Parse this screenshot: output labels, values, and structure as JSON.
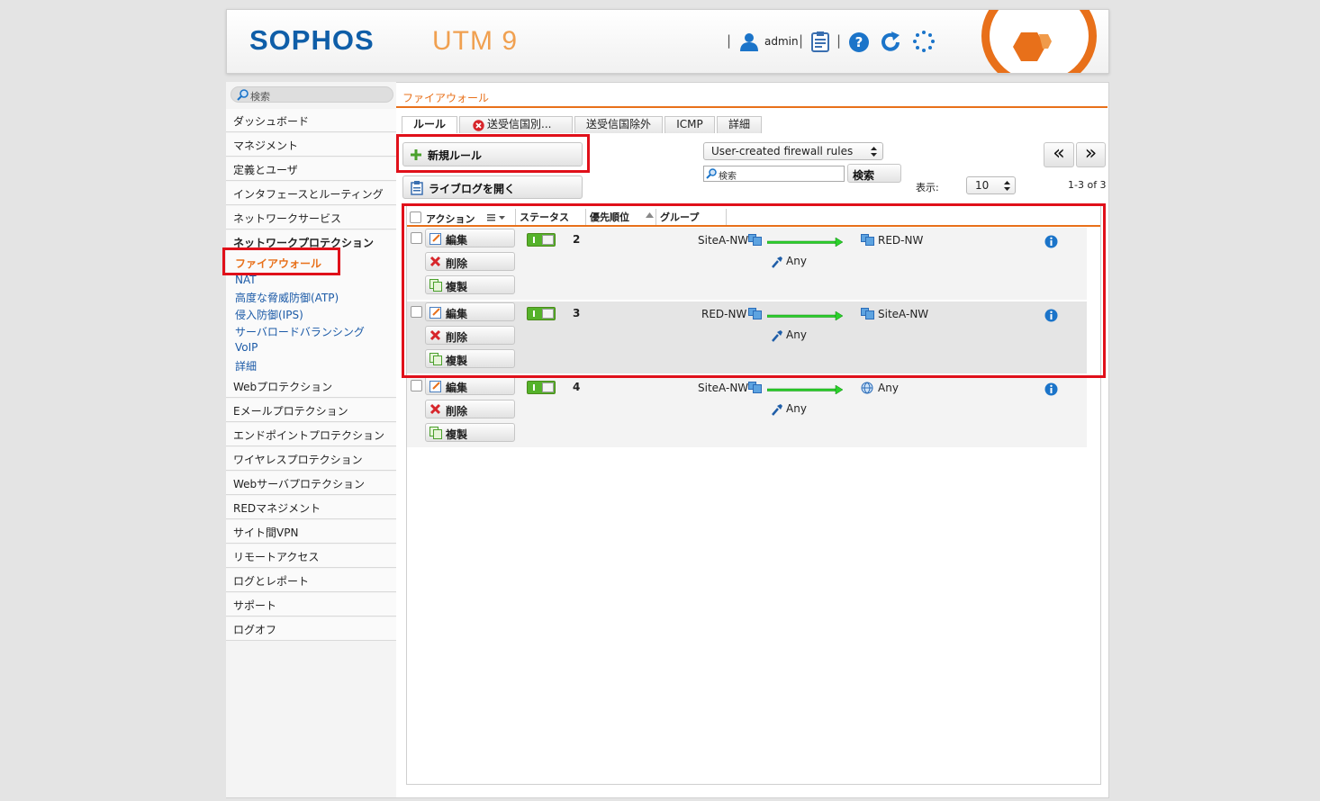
{
  "header": {
    "logo": "SOPHOS",
    "product": "UTM 9",
    "username": "admin",
    "separator": "|"
  },
  "sidebar": {
    "search_placeholder": "検索",
    "items": [
      {
        "label": "ダッシュボード"
      },
      {
        "label": "マネジメント"
      },
      {
        "label": "定義とユーザ"
      },
      {
        "label": "インタフェースとルーティング"
      },
      {
        "label": "ネットワークサービス"
      },
      {
        "label": "ネットワークプロテクション"
      },
      {
        "label": "Webプロテクション"
      },
      {
        "label": "Eメールプロテクション"
      },
      {
        "label": "エンドポイントプロテクション"
      },
      {
        "label": "ワイヤレスプロテクション"
      },
      {
        "label": "Webサーバプロテクション"
      },
      {
        "label": "REDマネジメント"
      },
      {
        "label": "サイト間VPN"
      },
      {
        "label": "リモートアクセス"
      },
      {
        "label": "ログとレポート"
      },
      {
        "label": "サポート"
      },
      {
        "label": "ログオフ"
      }
    ],
    "subitems": [
      {
        "label": "ファイアウォール"
      },
      {
        "label": "NAT"
      },
      {
        "label": "高度な脅威防御(ATP)"
      },
      {
        "label": "侵入防御(IPS)"
      },
      {
        "label": "サーバロードバランシング"
      },
      {
        "label": "VoIP"
      },
      {
        "label": "詳細"
      }
    ]
  },
  "main": {
    "breadcrumb": "ファイアウォール",
    "tabs": [
      {
        "label": "ルール"
      },
      {
        "label": "送受信国別..."
      },
      {
        "label": "送受信国除外"
      },
      {
        "label": "ICMP"
      },
      {
        "label": "詳細"
      }
    ],
    "new_rule_label": "新規ルール",
    "live_log_label": "ライブログを開く",
    "filter_value": "User-created firewall rules",
    "search_placeholder": "検索",
    "search_button": "検索",
    "per_page_label": "表示:",
    "per_page_value": "10",
    "range_text": "1-3 of 3",
    "prev_label": "«",
    "next_label": "»",
    "columns": {
      "action": "アクション",
      "status": "ステータス",
      "priority": "優先順位",
      "group": "グループ"
    },
    "edit_label": "編集",
    "delete_label": "削除",
    "clone_label": "複製",
    "rules": [
      {
        "position": "2",
        "source": "SiteA-NW",
        "service": "Any",
        "destination": "RED-NW",
        "enabled": true
      },
      {
        "position": "3",
        "source": "RED-NW",
        "service": "Any",
        "destination": "SiteA-NW",
        "enabled": true
      },
      {
        "position": "4",
        "source": "SiteA-NW",
        "service": "Any",
        "destination": "Any",
        "enabled": true
      }
    ]
  },
  "colors": {
    "brand": "#0f5ea8",
    "accent": "#e8701a",
    "highlight": "#e0101a",
    "enabled": "#55b22a"
  }
}
